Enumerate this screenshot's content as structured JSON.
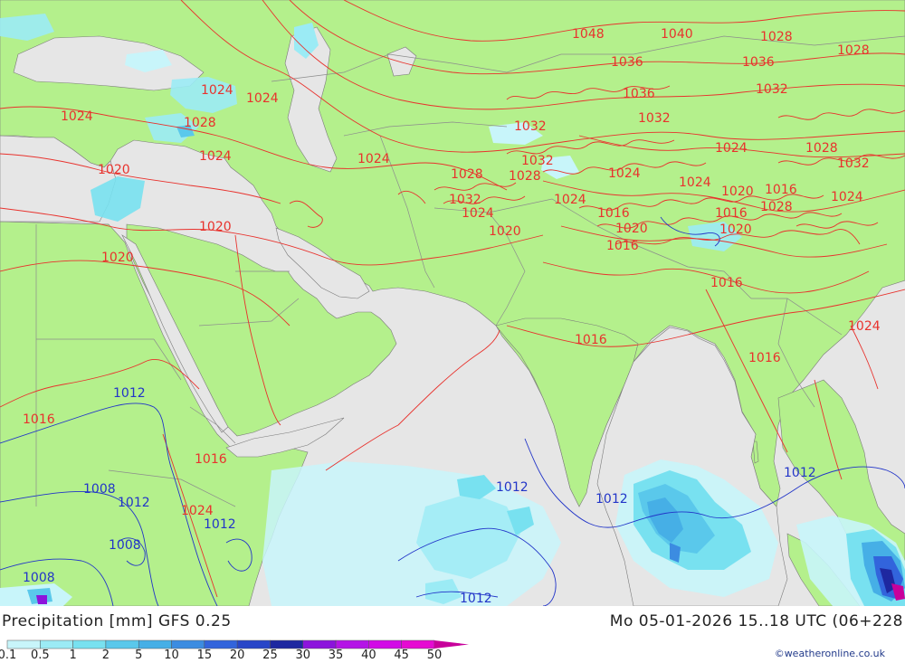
{
  "title": {
    "left": "Precipitation [mm]  GFS  0.25",
    "right": "Mo 05-01-2026 15..18 UTC (06+228"
  },
  "credit": "©weatheronline.co.uk",
  "colors": {
    "land": "#b4f08c",
    "sea": "#e6e6e6",
    "isobar_high": "#e8322d",
    "isobar_low": "#2235c8",
    "border": "#888888"
  },
  "legend": {
    "ticks": [
      "0.1",
      "0.5",
      "1",
      "2",
      "5",
      "10",
      "15",
      "20",
      "25",
      "30",
      "35",
      "40",
      "45",
      "50"
    ],
    "swatches": [
      "#c8f5fa",
      "#9bebf5",
      "#78e1f0",
      "#5ac8eb",
      "#46afe6",
      "#3c8ce1",
      "#3264dc",
      "#2846c8",
      "#1e28a0",
      "#8c14dc",
      "#b414e6",
      "#d20ae6",
      "#e60ad2",
      "#c8009b"
    ]
  },
  "isobars": {
    "labels": [
      {
        "text": "1048"
      },
      {
        "text": "1040"
      },
      {
        "text": "1028"
      },
      {
        "text": "1028"
      },
      {
        "text": "1036"
      },
      {
        "text": "1036"
      },
      {
        "text": "1036"
      },
      {
        "text": "1032"
      },
      {
        "text": "1024"
      },
      {
        "text": "1024"
      },
      {
        "text": "1024"
      },
      {
        "text": "1028"
      },
      {
        "text": "1032"
      },
      {
        "text": "1032"
      },
      {
        "text": "1020"
      },
      {
        "text": "1024"
      },
      {
        "text": "1024"
      },
      {
        "text": "1024"
      },
      {
        "text": "1028"
      },
      {
        "text": "1028"
      },
      {
        "text": "1032"
      },
      {
        "text": "1028"
      },
      {
        "text": "1032"
      },
      {
        "text": "1032"
      },
      {
        "text": "1024"
      },
      {
        "text": "1024"
      },
      {
        "text": "1020"
      },
      {
        "text": "1016"
      },
      {
        "text": "1024"
      },
      {
        "text": "1024"
      },
      {
        "text": "1016"
      },
      {
        "text": "1016"
      },
      {
        "text": "1028"
      },
      {
        "text": "1024"
      },
      {
        "text": "1020"
      },
      {
        "text": "1020"
      },
      {
        "text": "1020"
      },
      {
        "text": "1020"
      },
      {
        "text": "1020"
      },
      {
        "text": "1016"
      },
      {
        "text": "1016"
      },
      {
        "text": "1024"
      },
      {
        "text": "1016"
      },
      {
        "text": "1016"
      },
      {
        "text": "1016"
      },
      {
        "text": "1016"
      },
      {
        "text": "1024"
      },
      {
        "text": "1012"
      },
      {
        "text": "1008"
      },
      {
        "text": "1012"
      },
      {
        "text": "1012"
      },
      {
        "text": "1008"
      },
      {
        "text": "1008"
      },
      {
        "text": "1012"
      },
      {
        "text": "1012"
      },
      {
        "text": "1012"
      },
      {
        "text": "1012"
      }
    ]
  }
}
